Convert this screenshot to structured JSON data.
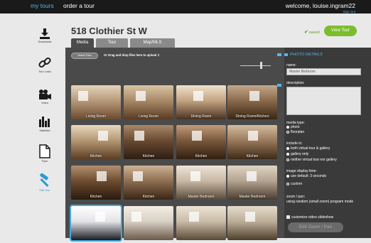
{
  "topbar": {
    "my_tours": "my tours",
    "order_tour": "order a tour",
    "welcome": "welcome, louise.ingram22",
    "sign_out": "Sign Out"
  },
  "sidebar": {
    "items": [
      {
        "label": "Downloads",
        "icon": "download-icon"
      },
      {
        "label": "Tour Links",
        "icon": "link-icon"
      },
      {
        "label": "Video",
        "icon": "video-camera-icon"
      },
      {
        "label": "Statistics",
        "icon": "bar-chart-icon"
      },
      {
        "label": "Flyer",
        "icon": "document-icon"
      },
      {
        "label": "Edit Tour",
        "icon": "hammer-icon"
      }
    ]
  },
  "header": {
    "title": "518 Clothier St W",
    "saved": "saved",
    "view_tour": "View Tour"
  },
  "tabs": [
    {
      "label": "Media",
      "active": true
    },
    {
      "label": "Tour",
      "active": false
    },
    {
      "label": "Map/MLS",
      "active": false
    }
  ],
  "upload": {
    "select_files": "Select Files",
    "drop_text": "Or Drag and drop files here to upload"
  },
  "thumbnails": [
    {
      "caption": "Living Room"
    },
    {
      "caption": "Living Room"
    },
    {
      "caption": "Dining Room"
    },
    {
      "caption": "Dining Room/Kitchen"
    },
    {
      "caption": "Kitchen"
    },
    {
      "caption": "Kitchen"
    },
    {
      "caption": "Kitchen"
    },
    {
      "caption": "Kitchen"
    },
    {
      "caption": "Kitchen"
    },
    {
      "caption": "Kitchen"
    },
    {
      "caption": "Master Bedroom"
    },
    {
      "caption": "Master Bedroom"
    },
    {
      "caption": ""
    },
    {
      "caption": ""
    },
    {
      "caption": ""
    },
    {
      "caption": ""
    }
  ],
  "details": {
    "heading": "PHOTO DETAILS",
    "name_label": "name:",
    "name_value": "Master Bedroom",
    "description_label": "description:",
    "media_type_label": "media type:",
    "media_type_options": [
      "photo",
      "floorplan"
    ],
    "include_label": "include in:",
    "include_options": [
      "both virtual tour & gallery",
      "gallery only",
      "neither virtual tour nor gallery"
    ],
    "display_time_label": "image display time:",
    "display_time_options": [
      "use default: 3 seconds",
      "custom"
    ],
    "zoom_label": "zoom / pan:",
    "zoom_text": "using random (small zoom) program mode",
    "customize_label": "customize video slideshow",
    "edit_zoom": "Edit Zoom / Pan"
  },
  "colors": {
    "accent_blue": "#58b6e6",
    "green": "#7cbd2e",
    "panel_dark": "#4a4a4a",
    "details_dark": "#3a3a3a"
  }
}
